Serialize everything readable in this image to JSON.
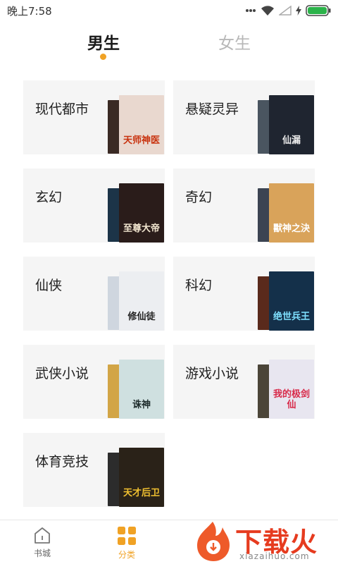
{
  "status_bar": {
    "time": "晚上7:58"
  },
  "tabs": [
    {
      "label": "男生",
      "active": true
    },
    {
      "label": "女生",
      "active": false
    }
  ],
  "accent_color": "#f0a225",
  "categories": [
    {
      "name": "现代都市",
      "cover_text": "天师神医",
      "cover_bg": "#e9d8cf",
      "back_bg": "#3a2a24"
    },
    {
      "name": "悬疑灵异",
      "cover_text": "仙漏",
      "cover_bg": "#1f2530",
      "back_bg": "#4a5560"
    },
    {
      "name": "玄幻",
      "cover_text": "至尊大帝",
      "cover_bg": "#2a1c1a",
      "back_bg": "#1c3448"
    },
    {
      "name": "奇幻",
      "cover_text": "獸神之決",
      "cover_bg": "#d9a35a",
      "back_bg": "#3c4452"
    },
    {
      "name": "仙侠",
      "cover_text": "修仙徒",
      "cover_bg": "#eceef1",
      "back_bg": "#cfd6df"
    },
    {
      "name": "科幻",
      "cover_text": "绝世兵王",
      "cover_bg": "#14304a",
      "back_bg": "#5a2a1c"
    },
    {
      "name": "武侠小说",
      "cover_text": "诛神",
      "cover_bg": "#cfe0e0",
      "back_bg": "#d2a546"
    },
    {
      "name": "游戏小说",
      "cover_text": "我的极剑仙",
      "cover_bg": "#e8e6f0",
      "back_bg": "#4b4538"
    },
    {
      "name": "体育竞技",
      "cover_text": "天才后卫",
      "cover_bg": "#2a2218",
      "back_bg": "#2c2c2c"
    }
  ],
  "nav": {
    "store_label": "书城",
    "category_label": "分类"
  },
  "watermark": {
    "text": "下载火",
    "url": "xiazaihuo.com"
  }
}
